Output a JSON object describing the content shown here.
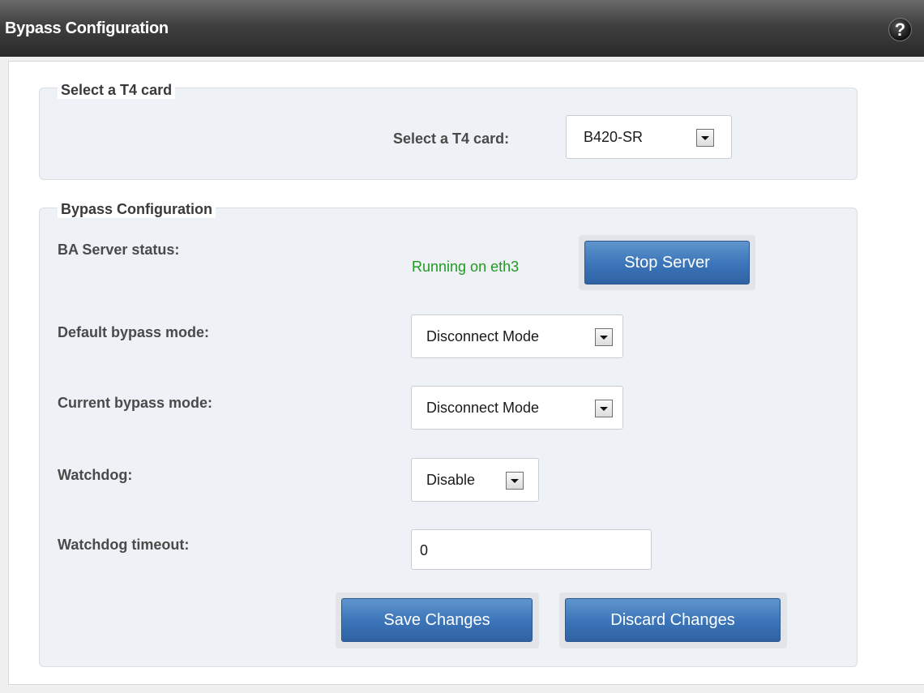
{
  "header": {
    "title": "Bypass Configuration",
    "help_glyph": "?"
  },
  "card_section": {
    "legend": "Select a T4 card",
    "select_label": "Select a T4 card:",
    "select_value": "B420-SR"
  },
  "bypass_section": {
    "legend": "Bypass Configuration",
    "server_status_label": "BA Server status:",
    "server_status_value": "Running on eth3",
    "server_status_color": "#229922",
    "stop_server_label": "Stop Server",
    "default_mode_label": "Default bypass mode:",
    "default_mode_value": "Disconnect Mode",
    "current_mode_label": "Current bypass mode:",
    "current_mode_value": "Disconnect Mode",
    "watchdog_label": "Watchdog:",
    "watchdog_value": "Disable",
    "timeout_label": "Watchdog timeout:",
    "timeout_value": "0",
    "save_label": "Save Changes",
    "discard_label": "Discard Changes"
  },
  "colors": {
    "button_blue": "#3b74b8",
    "header_dark": "#2a2a2a"
  }
}
